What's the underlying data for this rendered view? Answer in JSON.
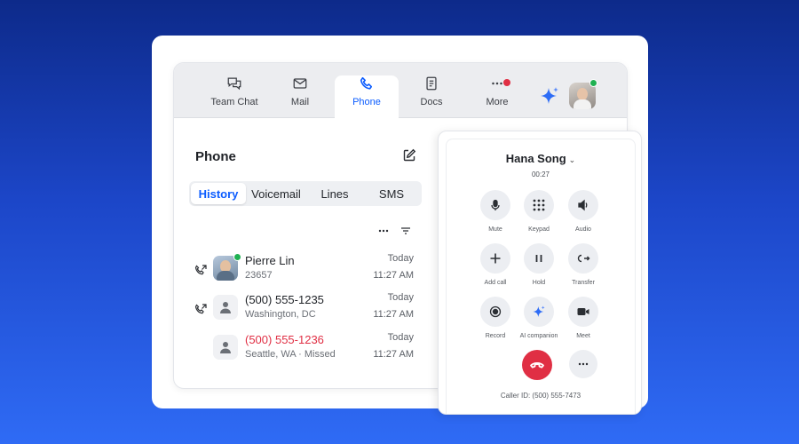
{
  "nav": {
    "tabs": [
      {
        "label": "Team Chat",
        "icon": "chat-icon"
      },
      {
        "label": "Mail",
        "icon": "mail-icon"
      },
      {
        "label": "Phone",
        "icon": "phone-icon",
        "active": true
      },
      {
        "label": "Docs",
        "icon": "docs-icon"
      },
      {
        "label": "More",
        "icon": "more-icon",
        "notification": true
      }
    ]
  },
  "phone": {
    "title": "Phone",
    "tabs": [
      "History",
      "Voicemail",
      "Lines",
      "SMS"
    ],
    "active_tab": "History",
    "calls": [
      {
        "name": "Pierre Lin",
        "sub": "23657",
        "date": "Today",
        "time": "11:27 AM",
        "missed": false
      },
      {
        "name": "(500) 555-1235",
        "sub": "Washington, DC",
        "date": "Today",
        "time": "11:27 AM",
        "missed": false
      },
      {
        "name": "(500) 555-1236",
        "sub": "Seattle, WA · Missed",
        "date": "Today",
        "time": "11:27 AM",
        "missed": true
      }
    ]
  },
  "call": {
    "caller": "Hana Song",
    "timer": "00:27",
    "controls": [
      "Mute",
      "Keypad",
      "Audio",
      "Add call",
      "Hold",
      "Transfer",
      "Record",
      "AI companion",
      "Meet"
    ],
    "caller_id": "Caller ID: (500) 555-7473"
  },
  "colors": {
    "accent": "#0b5cff",
    "missed": "#e02f44",
    "online": "#1fb152",
    "end_call": "#e02f44"
  }
}
